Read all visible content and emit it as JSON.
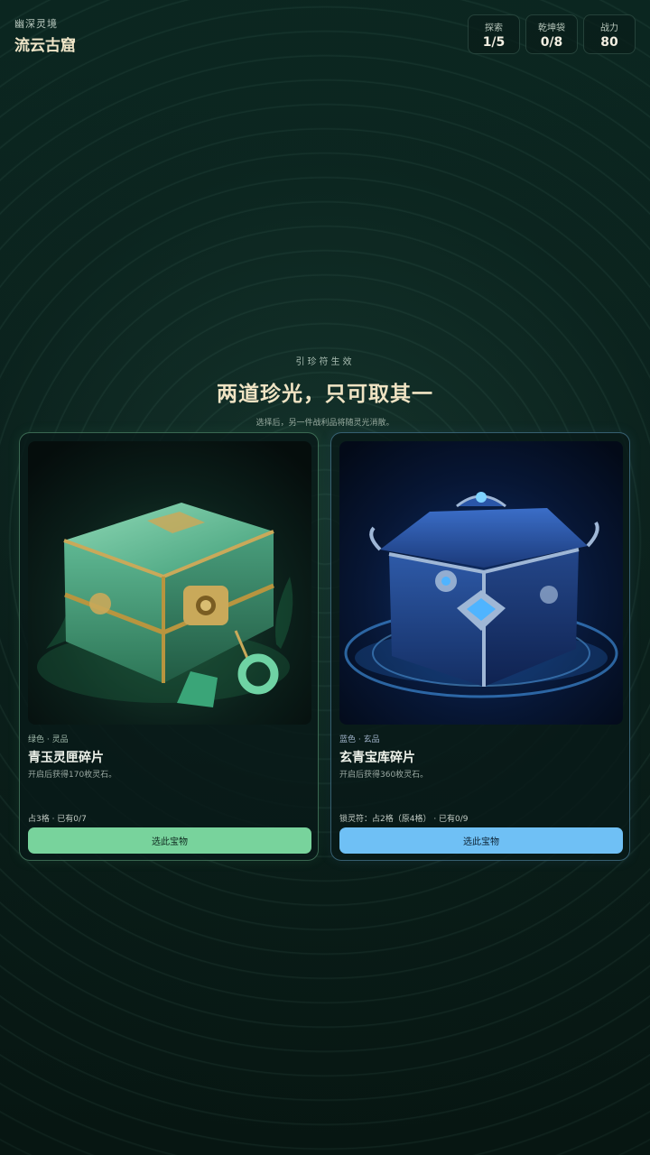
{
  "header": {
    "region_label": "幽深灵境",
    "location_title": "流云古窟",
    "stats": [
      {
        "label": "探索",
        "value": "1/5"
      },
      {
        "label": "乾坤袋",
        "value": "0/8"
      },
      {
        "label": "战力",
        "value": "80"
      }
    ]
  },
  "intro": {
    "eyebrow": "引珍符生效",
    "title": "两道珍光，只可取其一",
    "subtitle": "选择后，另一件战利品将随灵光消散。"
  },
  "cards": [
    {
      "rarity": "绿色 · 灵品",
      "name": "青玉灵匣碎片",
      "description": "开启后获得170枚灵石。",
      "slot_info": "占3格 · 已有0/7",
      "button_label": "选此宝物",
      "accent": "#78d39c",
      "image": "jade-chest-image"
    },
    {
      "rarity": "蓝色 · 玄品",
      "name": "玄青宝库碎片",
      "description": "开启后获得360枚灵石。",
      "slot_info": "锁灵符：占2格（原4格） · 已有0/9",
      "button_label": "选此宝物",
      "accent": "#6fc0f5",
      "image": "azure-treasury-chest-image"
    }
  ]
}
